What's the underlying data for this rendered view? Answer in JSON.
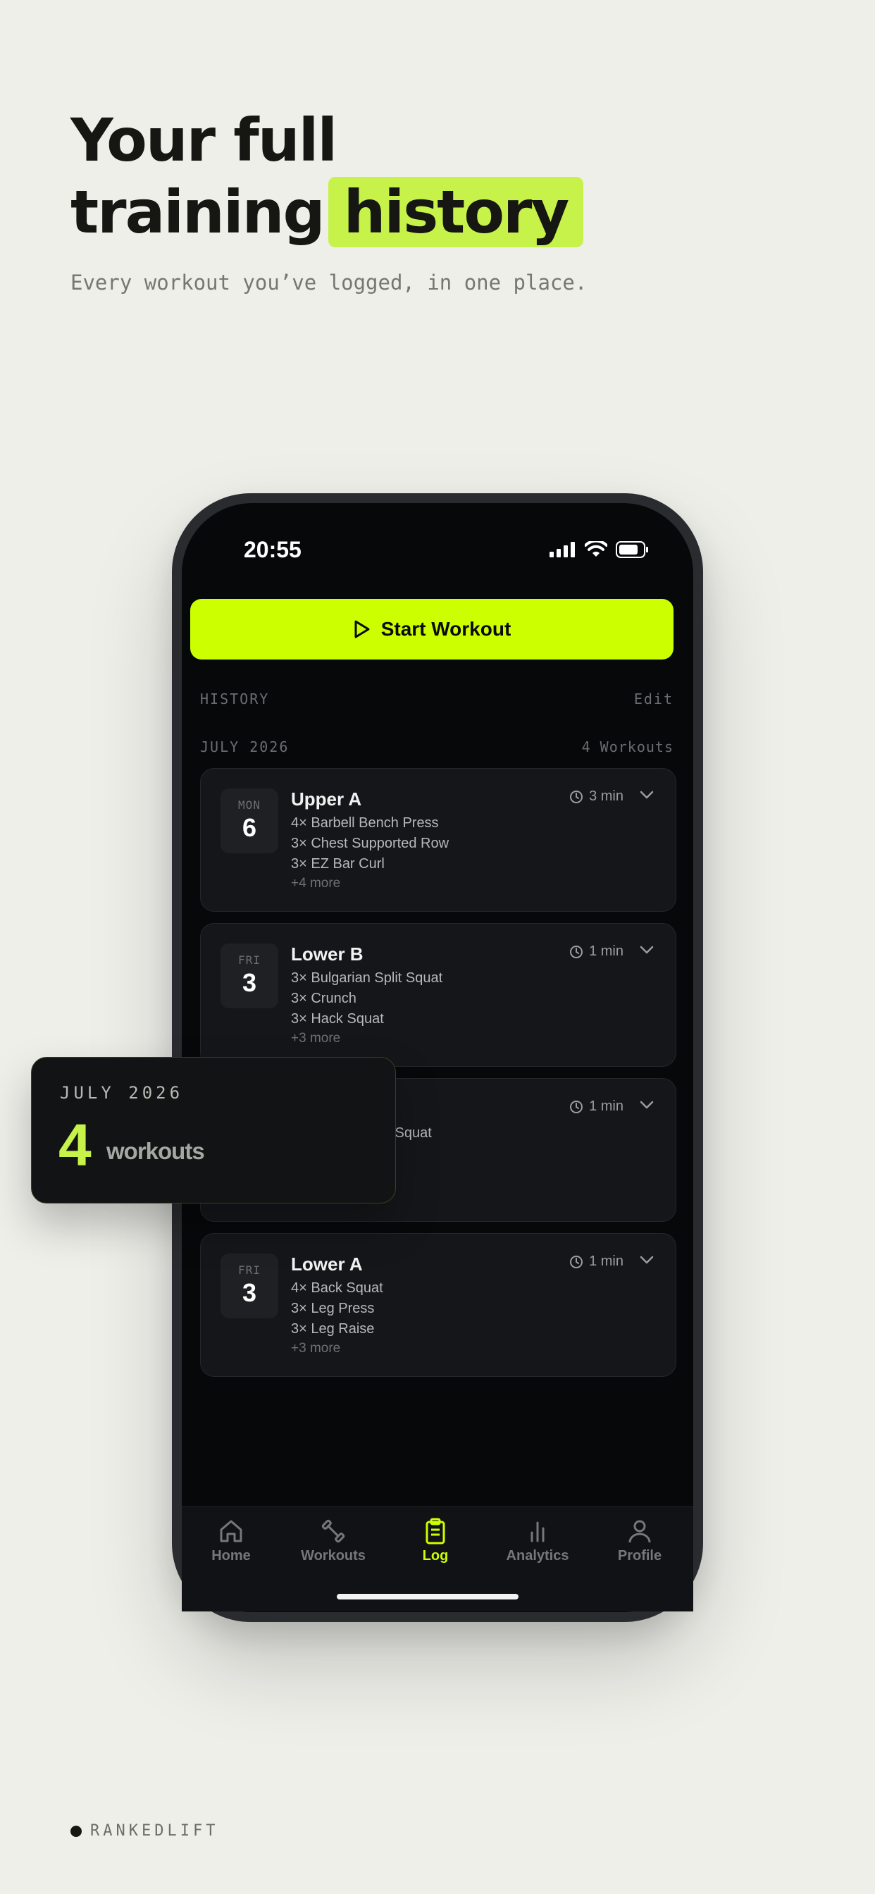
{
  "hero": {
    "line1": "Your full",
    "line2": "training",
    "highlight": "history",
    "subtitle": "Every workout you’ve logged, in one place."
  },
  "status_bar": {
    "time": "20:55"
  },
  "start_button": {
    "label": "Start Workout"
  },
  "history": {
    "heading": "HISTORY",
    "edit_label": "Edit",
    "month": "JULY 2026",
    "count_label": "4 Workouts",
    "workouts": [
      {
        "dow": "MON",
        "day": "6",
        "title": "Upper A",
        "duration": "3 min",
        "exercises": [
          "4× Barbell Bench Press",
          "3× Chest Supported Row",
          "3× EZ Bar Curl"
        ],
        "more": "+4 more"
      },
      {
        "dow": "FRI",
        "day": "3",
        "title": "Lower B",
        "duration": "1 min",
        "exercises": [
          "3× Bulgarian Split Squat",
          "3× Crunch",
          "3× Hack Squat"
        ],
        "more": "+3 more"
      },
      {
        "dow": "",
        "day": "",
        "title": "",
        "duration": "1 min",
        "exercises": [
          "it Squat"
        ],
        "more": ""
      },
      {
        "dow": "FRI",
        "day": "3",
        "title": "Lower A",
        "duration": "1 min",
        "exercises": [
          "4× Back Squat",
          "3× Leg Press",
          "3× Leg Raise"
        ],
        "more": "+3 more"
      }
    ]
  },
  "summary_card": {
    "month": "JULY 2026",
    "count": "4",
    "label": "workouts"
  },
  "tabbar": {
    "tabs": [
      {
        "label": "Home",
        "icon": "home-icon"
      },
      {
        "label": "Workouts",
        "icon": "dumbbell-icon"
      },
      {
        "label": "Log",
        "icon": "clipboard-icon"
      },
      {
        "label": "Analytics",
        "icon": "bar-chart-icon"
      },
      {
        "label": "Profile",
        "icon": "user-icon"
      }
    ],
    "active": "Log"
  },
  "brand": {
    "name": "RANKEDLIFT"
  },
  "colors": {
    "accent": "#ccff00",
    "highlight": "#c6f24a",
    "background": "#efefea",
    "screen": "#07080a"
  }
}
